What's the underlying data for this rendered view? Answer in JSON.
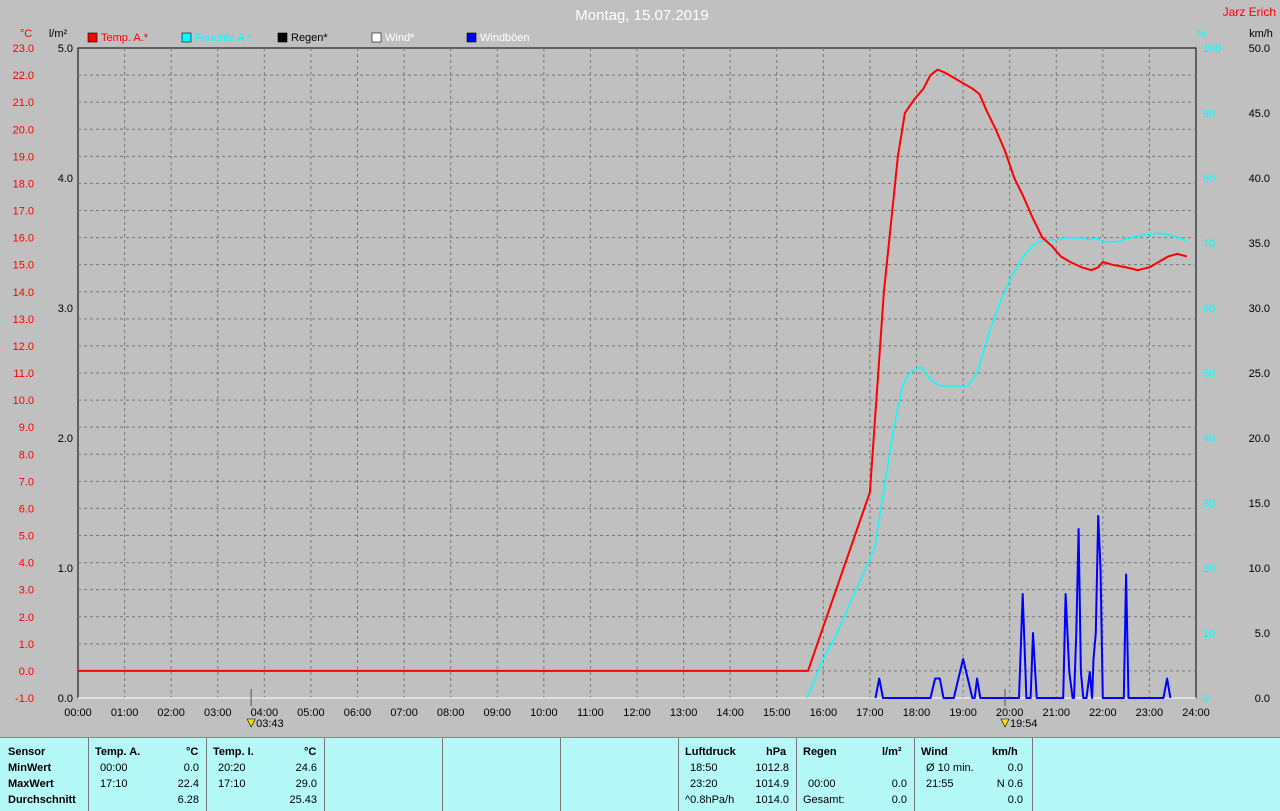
{
  "title": "Montag, 15.07.2019",
  "author": "Jarz Erich",
  "axes": {
    "temp_unit": "°C",
    "rain_unit": "l/m²",
    "hum_unit": "%",
    "wind_unit": "km/h",
    "temp_ticks": [
      "23.0",
      "22.0",
      "21.0",
      "20.0",
      "19.0",
      "18.0",
      "17.0",
      "16.0",
      "15.0",
      "14.0",
      "13.0",
      "12.0",
      "11.0",
      "10.0",
      "9.0",
      "8.0",
      "7.0",
      "6.0",
      "5.0",
      "4.0",
      "3.0",
      "2.0",
      "1.0",
      "0.0",
      "-1.0"
    ],
    "rain_ticks": [
      "5.0",
      "4.0",
      "3.0",
      "2.0",
      "1.0",
      "0.0"
    ],
    "hum_ticks": [
      "100",
      "90",
      "80",
      "70",
      "60",
      "50",
      "40",
      "30",
      "20",
      "10",
      "0"
    ],
    "wind_ticks": [
      "50.0",
      "45.0",
      "40.0",
      "35.0",
      "30.0",
      "25.0",
      "20.0",
      "15.0",
      "10.0",
      "5.0",
      "0.0"
    ],
    "time_ticks": [
      "00:00",
      "01:00",
      "02:00",
      "03:00",
      "04:00",
      "05:00",
      "06:00",
      "07:00",
      "08:00",
      "09:00",
      "10:00",
      "11:00",
      "12:00",
      "13:00",
      "14:00",
      "15:00",
      "16:00",
      "17:00",
      "18:00",
      "19:00",
      "20:00",
      "21:00",
      "22:00",
      "23:00",
      "24:00"
    ]
  },
  "sunrise": "03:43",
  "sunset": "19:54",
  "legend": [
    {
      "label": "Temp. A.*",
      "color": "#ff0000"
    },
    {
      "label": "Feuchte A.*",
      "color": "#00ffff"
    },
    {
      "label": "Regen*",
      "color": "#000000"
    },
    {
      "label": "Wind*",
      "color": "#ffffff"
    },
    {
      "label": "Windböen",
      "color": "#0000ff"
    }
  ],
  "chart_data": {
    "type": "line",
    "x_unit": "hours",
    "xlim": [
      0,
      24
    ],
    "ylim_temp": [
      -1,
      23
    ],
    "ylim_rain": [
      0,
      5
    ],
    "ylim_hum": [
      0,
      100
    ],
    "ylim_wind": [
      0,
      50
    ],
    "series": [
      {
        "name": "Temp. A.*",
        "color": "#ff0000",
        "axis": "temp",
        "points": [
          [
            0,
            0.0
          ],
          [
            15.67,
            0.0
          ],
          [
            17.0,
            6.6
          ],
          [
            17.2,
            11.5
          ],
          [
            17.3,
            14.0
          ],
          [
            17.45,
            16.5
          ],
          [
            17.6,
            19.0
          ],
          [
            17.75,
            20.6
          ],
          [
            17.95,
            21.1
          ],
          [
            18.15,
            21.5
          ],
          [
            18.3,
            22.0
          ],
          [
            18.45,
            22.2
          ],
          [
            18.6,
            22.1
          ],
          [
            18.8,
            21.9
          ],
          [
            19.0,
            21.7
          ],
          [
            19.2,
            21.5
          ],
          [
            19.35,
            21.3
          ],
          [
            19.5,
            20.7
          ],
          [
            19.7,
            20.0
          ],
          [
            19.9,
            19.2
          ],
          [
            20.1,
            18.2
          ],
          [
            20.3,
            17.5
          ],
          [
            20.5,
            16.7
          ],
          [
            20.7,
            16.0
          ],
          [
            20.9,
            15.7
          ],
          [
            21.1,
            15.3
          ],
          [
            21.3,
            15.1
          ],
          [
            21.55,
            14.9
          ],
          [
            21.75,
            14.8
          ],
          [
            21.9,
            14.9
          ],
          [
            22.0,
            15.1
          ],
          [
            22.2,
            15.0
          ],
          [
            22.5,
            14.9
          ],
          [
            22.75,
            14.8
          ],
          [
            23.0,
            14.9
          ],
          [
            23.2,
            15.1
          ],
          [
            23.4,
            15.3
          ],
          [
            23.6,
            15.4
          ],
          [
            23.8,
            15.3
          ]
        ]
      },
      {
        "name": "Feuchte A.*",
        "color": "#00ffff",
        "axis": "hum",
        "points": [
          [
            15.65,
            0
          ],
          [
            16.0,
            6
          ],
          [
            16.3,
            10
          ],
          [
            16.6,
            15
          ],
          [
            16.85,
            19
          ],
          [
            17.1,
            23
          ],
          [
            17.3,
            32
          ],
          [
            17.5,
            41
          ],
          [
            17.7,
            48
          ],
          [
            17.85,
            50
          ],
          [
            18.1,
            51
          ],
          [
            18.3,
            49
          ],
          [
            18.5,
            48
          ],
          [
            18.8,
            48
          ],
          [
            19.1,
            48
          ],
          [
            19.3,
            50
          ],
          [
            19.55,
            56
          ],
          [
            19.8,
            61
          ],
          [
            20.05,
            65
          ],
          [
            20.3,
            68
          ],
          [
            20.55,
            70
          ],
          [
            20.8,
            70.5
          ],
          [
            21.0,
            70.5
          ],
          [
            21.2,
            70.8
          ],
          [
            21.5,
            70.8
          ],
          [
            21.7,
            70.5
          ],
          [
            21.85,
            70.7
          ],
          [
            22.05,
            70.2
          ],
          [
            22.3,
            70.2
          ],
          [
            22.6,
            70.8
          ],
          [
            22.9,
            71.3
          ],
          [
            23.2,
            71.5
          ],
          [
            23.45,
            71.2
          ],
          [
            23.65,
            70.8
          ],
          [
            23.8,
            70.3
          ]
        ]
      },
      {
        "name": "Regen*",
        "color": "#000000",
        "axis": "rain",
        "points": [
          [
            0,
            0
          ],
          [
            24,
            0
          ]
        ]
      },
      {
        "name": "Wind*",
        "color": "#ffffff",
        "axis": "wind",
        "points": [
          [
            0,
            0
          ],
          [
            24,
            0
          ]
        ]
      },
      {
        "name": "Windböen",
        "color": "#0000ff",
        "axis": "wind",
        "points": [
          [
            17.12,
            0
          ],
          [
            17.2,
            1.5
          ],
          [
            17.28,
            0
          ],
          [
            18.3,
            0
          ],
          [
            18.4,
            1.5
          ],
          [
            18.5,
            1.5
          ],
          [
            18.58,
            0
          ],
          [
            18.8,
            0
          ],
          [
            19.0,
            3.0
          ],
          [
            19.2,
            0
          ],
          [
            19.25,
            0
          ],
          [
            19.3,
            1.5
          ],
          [
            19.37,
            0
          ],
          [
            20.2,
            0
          ],
          [
            20.28,
            8.0
          ],
          [
            20.36,
            0
          ],
          [
            20.45,
            0
          ],
          [
            20.5,
            5.0
          ],
          [
            20.58,
            0
          ],
          [
            21.15,
            0
          ],
          [
            21.2,
            8.0
          ],
          [
            21.28,
            2.0
          ],
          [
            21.35,
            0
          ],
          [
            21.38,
            0
          ],
          [
            21.43,
            5.0
          ],
          [
            21.48,
            13.0
          ],
          [
            21.53,
            2.0
          ],
          [
            21.58,
            0
          ],
          [
            21.65,
            0
          ],
          [
            21.72,
            2.0
          ],
          [
            21.77,
            0
          ],
          [
            21.8,
            3.0
          ],
          [
            21.85,
            5.0
          ],
          [
            21.9,
            14.0
          ],
          [
            21.95,
            10.0
          ],
          [
            22.0,
            0
          ],
          [
            22.45,
            0
          ],
          [
            22.5,
            9.5
          ],
          [
            22.55,
            0
          ],
          [
            23.3,
            0
          ],
          [
            23.38,
            1.5
          ],
          [
            23.45,
            0
          ]
        ]
      }
    ]
  },
  "stats": {
    "sensor": {
      "header": "Sensor",
      "rows": [
        "MinWert",
        "MaxWert",
        "Durchschnitt"
      ]
    },
    "temp_a": {
      "header": "Temp. A.",
      "unit": "°C",
      "min_time": "00:00",
      "min_val": "0.0",
      "max_time": "17:10",
      "max_val": "22.4",
      "avg": "6.28"
    },
    "temp_i": {
      "header": "Temp. I.",
      "unit": "°C",
      "min_time": "20:20",
      "min_val": "24.6",
      "max_time": "17:10",
      "max_val": "29.0",
      "avg": "25.43"
    },
    "pressure": {
      "header": "Luftdruck",
      "unit": "hPa",
      "min_time": "18:50",
      "min_val": "1012.8",
      "max_time": "23:20",
      "max_val": "1014.9",
      "avg_label": "^0.8hPa/h",
      "avg": "1014.0"
    },
    "rain": {
      "header": "Regen",
      "unit": "l/m²",
      "max_time": "00:00",
      "max_val": "0.0",
      "total_label": "Gesamt:",
      "total": "0.0"
    },
    "wind": {
      "header": "Wind",
      "unit": "km/h",
      "min_label": "Ø 10 min.",
      "min_val": "0.0",
      "max_time": "21:55",
      "max_val": "N 0.6",
      "avg": "0.0"
    }
  }
}
